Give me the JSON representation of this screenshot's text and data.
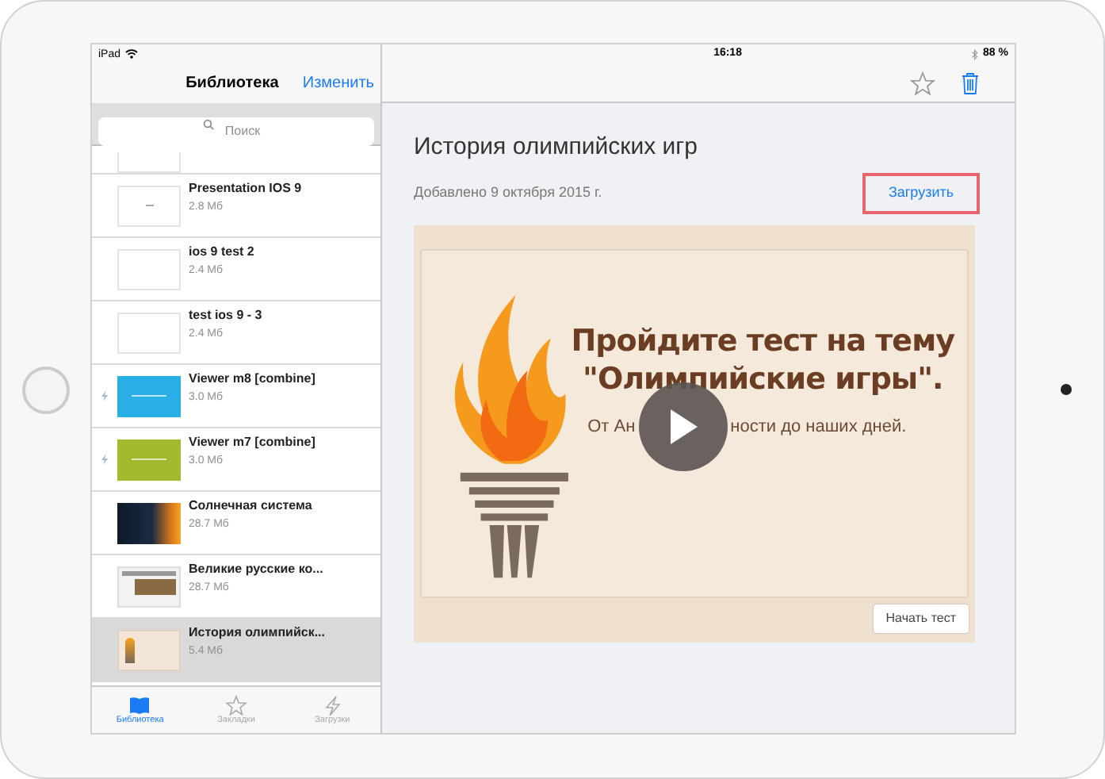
{
  "status_bar": {
    "device": "iPad",
    "time": "16:18",
    "battery": "88 %"
  },
  "sidebar": {
    "title": "Библиотека",
    "edit_button": "Изменить",
    "search": {
      "placeholder": "Поиск"
    },
    "items": [
      {
        "title": "Presentation IOS 9",
        "size": "2.8 Мб",
        "kind": "dash",
        "synced": false,
        "selected": false
      },
      {
        "title": "ios 9 test 2",
        "size": "2.4 Мб",
        "kind": "blank",
        "synced": false,
        "selected": false
      },
      {
        "title": "test ios 9 - 3",
        "size": "2.4 Мб",
        "kind": "blank",
        "synced": false,
        "selected": false
      },
      {
        "title": "Viewer m8 [combine]",
        "size": "3.0 Мб",
        "kind": "blue",
        "synced": true,
        "selected": false
      },
      {
        "title": "Viewer m7 [combine]",
        "size": "3.0 Мб",
        "kind": "green",
        "synced": true,
        "selected": false
      },
      {
        "title": "Солнечная система",
        "size": "28.7 Мб",
        "kind": "space",
        "synced": false,
        "selected": false
      },
      {
        "title": "Великие русские ко...",
        "size": "28.7 Мб",
        "kind": "document",
        "synced": false,
        "selected": false
      },
      {
        "title": "История олимпийск...",
        "size": "5.4 Мб",
        "kind": "torch",
        "synced": false,
        "selected": true
      }
    ]
  },
  "tabs": [
    {
      "label": "Библиотека",
      "kind": "book",
      "selected": true
    },
    {
      "label": "Закладки",
      "kind": "star",
      "selected": false
    },
    {
      "label": "Загрузки",
      "kind": "bolt",
      "selected": false
    }
  ],
  "main": {
    "title": "История олимпийских игр",
    "date": "Добавлено 9 октября 2015 г.",
    "download_button": "Загрузить",
    "slide": {
      "heading_lines": [
        "Пройдите тест на тему",
        "\"Олимпийские игры\"."
      ],
      "subtitle_before": "От Ан",
      "subtitle_after": "ности до наших дней.",
      "start_button": "Начать тест"
    }
  }
}
